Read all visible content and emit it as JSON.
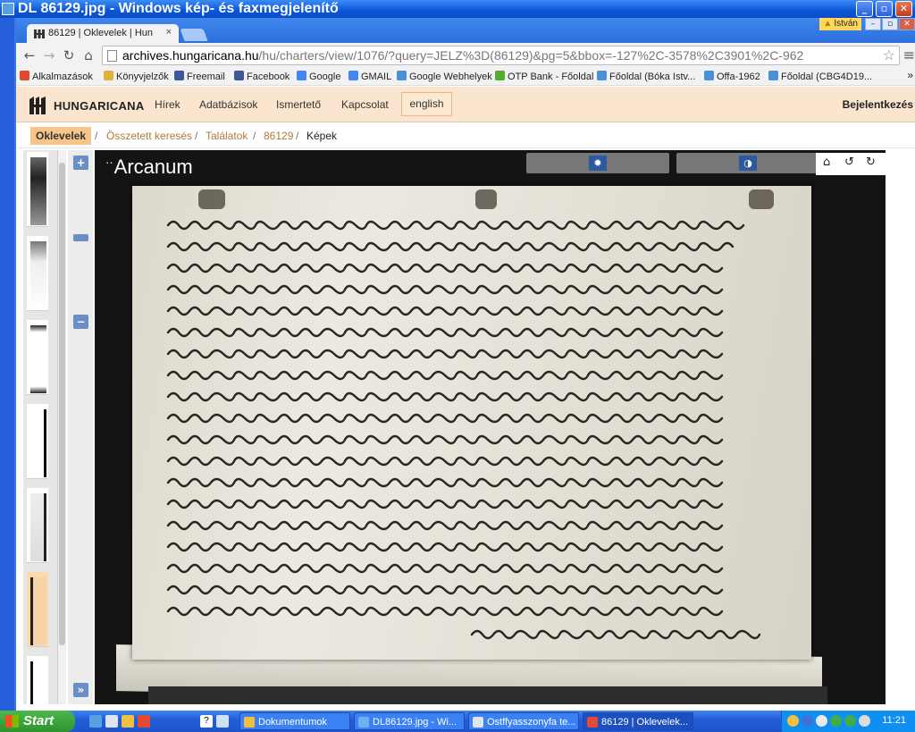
{
  "window": {
    "title": "DL 86129.jpg - Windows kép- és faxmegjelenítő"
  },
  "browser": {
    "tab_title": "86129 | Oklevelek | Hun",
    "tab_close": "×",
    "user_name": "István",
    "url_host": "archives.hungaricana.hu",
    "url_path": "/hu/charters/view/1076/?query=JELZ%3D(86129)&pg=5&bbox=-127%2C-3578%2C3901%2C-962",
    "bookmarks": [
      {
        "label": "Alkalmazások",
        "color": "#e0492f"
      },
      {
        "label": "Könyvjelzők",
        "color": "#e2b13c"
      },
      {
        "label": "Freemail",
        "color": "#3b5998"
      },
      {
        "label": "Facebook",
        "color": "#3b5998"
      },
      {
        "label": "Google",
        "color": "#4285f4"
      },
      {
        "label": "GMAIL",
        "color": "#4285f4"
      },
      {
        "label": "Google Webhelyek",
        "color": "#4a90d9"
      },
      {
        "label": "OTP Bank - Főoldal",
        "color": "#52ae30"
      },
      {
        "label": "Főoldal (Bóka Istv...",
        "color": "#4a90d9"
      },
      {
        "label": "Offa-1962",
        "color": "#4a90d9"
      },
      {
        "label": "Főoldal (CBG4D19...",
        "color": "#4a90d9"
      }
    ],
    "bookmarks_more": "»"
  },
  "site": {
    "logo_text": "HUNGARICANA",
    "nav": [
      "Hírek",
      "Adatbázisok",
      "Ismertető",
      "Kapcsolat"
    ],
    "lang_button": "english",
    "login": "Bejelentkezés"
  },
  "breadcrumb": {
    "root": "Oklevelek",
    "links": [
      "Összetett keresés",
      "Találatok",
      "86129"
    ],
    "current": "Képek"
  },
  "viewer": {
    "brand": "Arcanum",
    "zoom_in": "+",
    "zoom_out": "−",
    "expand": "»",
    "brightness_icon": "✹",
    "contrast_icon": "◑",
    "home_icon": "⌂",
    "rotate_left_icon": "↺",
    "rotate_right_icon": "↻"
  },
  "taskbar": {
    "start_label": "Start",
    "tasks": [
      {
        "label": "Dokumentumok",
        "color": "#f0c040"
      },
      {
        "label": "DL86129.jpg - Wi...",
        "color": "#6fb1f0"
      },
      {
        "label": "Ostffyasszonyfa te...",
        "color": "#dfe4ee"
      },
      {
        "label": "86129 | Oklevelek...",
        "color": "#e34a33"
      }
    ],
    "clock": "11:21"
  },
  "colors": {
    "site_header_bg": "#fbe5cf",
    "breadcrumb_root_bg": "#f7c48a",
    "viewer_bg": "#141414",
    "viewer_accent": "#2c5aa0",
    "taskbar": "#245edb",
    "start_green": "#2e932e"
  }
}
